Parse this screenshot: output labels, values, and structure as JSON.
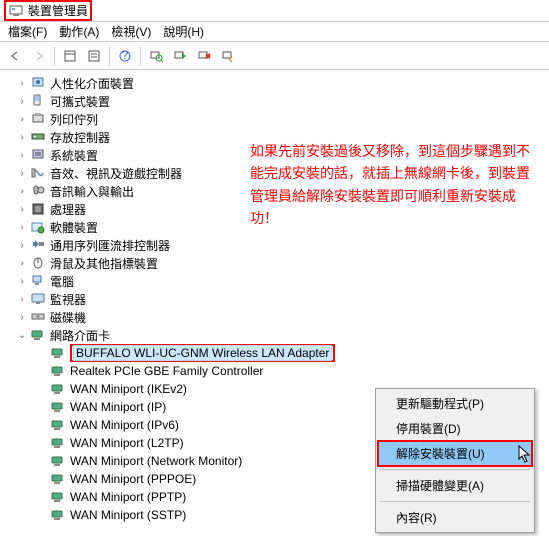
{
  "window": {
    "title": "裝置管理員"
  },
  "menu": {
    "file": "檔案(F)",
    "action": "動作(A)",
    "view": "檢視(V)",
    "help": "說明(H)"
  },
  "annotation": "如果先前安裝過後又移除，到這個步驟遇到不能完成安裝的話，就插上無線網卡後，到裝置管理員給解除安裝裝置即可順利重新安裝成功！",
  "tree": {
    "items": [
      "人性化介面裝置",
      "可攜式裝置",
      "列印佇列",
      "存放控制器",
      "系統裝置",
      "音效、視訊及遊戲控制器",
      "音訊輸入與輸出",
      "處理器",
      "軟體裝置",
      "通用序列匯流排控制器",
      "滑鼠及其他指標裝置",
      "電腦",
      "監視器",
      "磁碟機",
      "網路介面卡"
    ],
    "network_children": [
      "BUFFALO WLI-UC-GNM Wireless LAN Adapter",
      "Realtek PCIe GBE Family Controller",
      "WAN Miniport (IKEv2)",
      "WAN Miniport (IP)",
      "WAN Miniport (IPv6)",
      "WAN Miniport (L2TP)",
      "WAN Miniport (Network Monitor)",
      "WAN Miniport (PPPOE)",
      "WAN Miniport (PPTP)",
      "WAN Miniport (SSTP)"
    ]
  },
  "context_menu": {
    "update": "更新驅動程式(P)",
    "disable": "停用裝置(D)",
    "uninstall": "解除安裝裝置(U)",
    "scan": "掃描硬體變更(A)",
    "properties": "內容(R)"
  }
}
